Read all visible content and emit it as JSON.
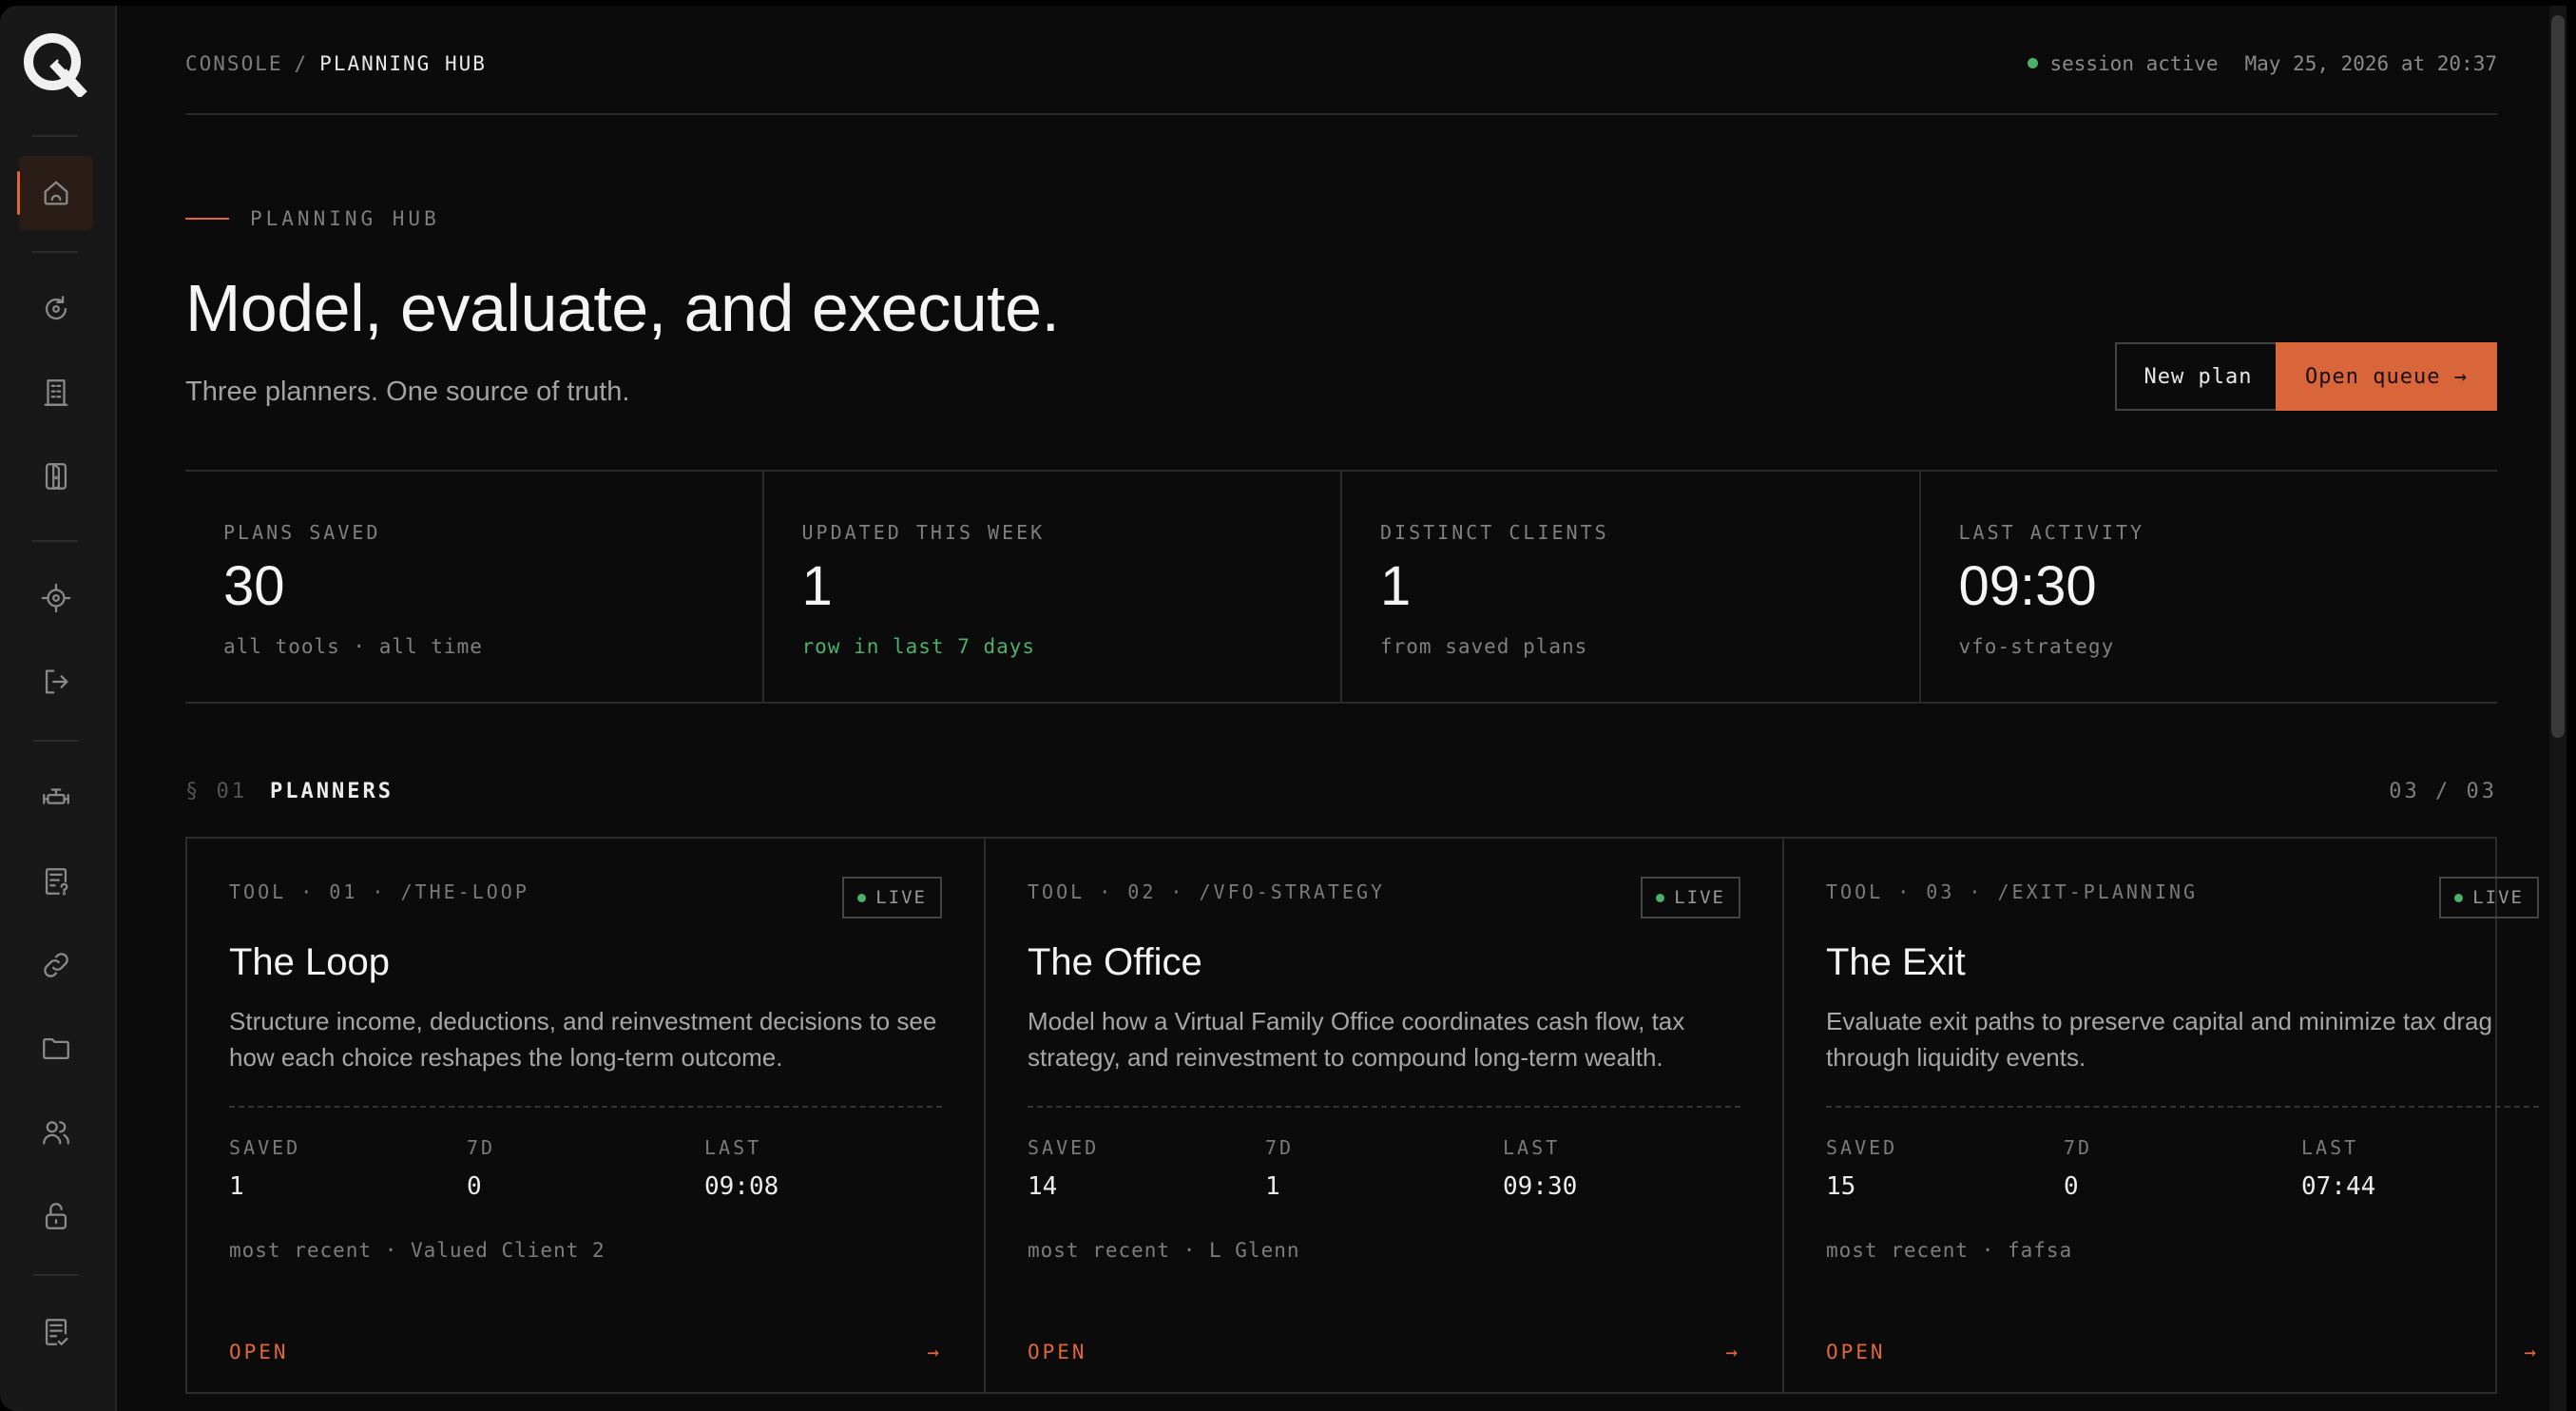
{
  "sidebar": {
    "items": [
      {
        "name": "home"
      },
      {
        "name": "refresh"
      },
      {
        "name": "building"
      },
      {
        "name": "door"
      },
      {
        "name": "target"
      },
      {
        "name": "logout"
      },
      {
        "name": "valve"
      },
      {
        "name": "document-question"
      },
      {
        "name": "link"
      },
      {
        "name": "folder"
      },
      {
        "name": "users"
      },
      {
        "name": "lock-open"
      },
      {
        "name": "clipboard-check"
      }
    ]
  },
  "header": {
    "crumb_root": "CONSOLE",
    "crumb_sep": "/",
    "crumb_current": "PLANNING HUB",
    "session_status": "session active",
    "datetime": "May 25, 2026 at 20:37"
  },
  "hero": {
    "eyebrow": "PLANNING HUB",
    "title": "Model, evaluate, and execute.",
    "subtitle": "Three planners. One source of truth.",
    "new_plan_label": "New plan",
    "open_queue_label": "Open queue →"
  },
  "stats": [
    {
      "label": "PLANS SAVED",
      "value": "30",
      "note": "all tools · all time"
    },
    {
      "label": "UPDATED THIS WEEK",
      "value": "1",
      "note": "row in last 7 days"
    },
    {
      "label": "DISTINCT CLIENTS",
      "value": "1",
      "note": "from saved plans"
    },
    {
      "label": "LAST ACTIVITY",
      "value": "09:30",
      "note": "vfo-strategy"
    }
  ],
  "section": {
    "num": "§ 01",
    "name": "PLANNERS",
    "count": "03 / 03"
  },
  "cards": [
    {
      "meta": "TOOL · 01 · /THE-LOOP",
      "status": "LIVE",
      "title": "The Loop",
      "desc": "Structure income, deductions, and reinvestment decisions to see how each choice reshapes the long-term outcome.",
      "saved_label": "SAVED",
      "saved": "1",
      "week_label": "7D",
      "week": "0",
      "last_label": "LAST",
      "last": "09:08",
      "recent": "most recent · Valued Client 2",
      "open_label": "OPEN",
      "arrow": "→"
    },
    {
      "meta": "TOOL · 02 · /VFO-STRATEGY",
      "status": "LIVE",
      "title": "The Office",
      "desc": "Model how a Virtual Family Office coordinates cash flow, tax strategy, and reinvestment to compound long-term wealth.",
      "saved_label": "SAVED",
      "saved": "14",
      "week_label": "7D",
      "week": "1",
      "last_label": "LAST",
      "last": "09:30",
      "recent": "most recent · L Glenn",
      "open_label": "OPEN",
      "arrow": "→"
    },
    {
      "meta": "TOOL · 03 · /EXIT-PLANNING",
      "status": "LIVE",
      "title": "The Exit",
      "desc": "Evaluate exit paths to preserve capital and minimize tax drag through liquidity events.",
      "saved_label": "SAVED",
      "saved": "15",
      "week_label": "7D",
      "week": "0",
      "last_label": "LAST",
      "last": "07:44",
      "recent": "most recent · fafsa",
      "open_label": "OPEN",
      "arrow": "→"
    }
  ],
  "colors": {
    "accent": "#d9653a",
    "live_green": "#4caf6a",
    "background": "#0b0b0b",
    "sidebar": "#181818"
  }
}
